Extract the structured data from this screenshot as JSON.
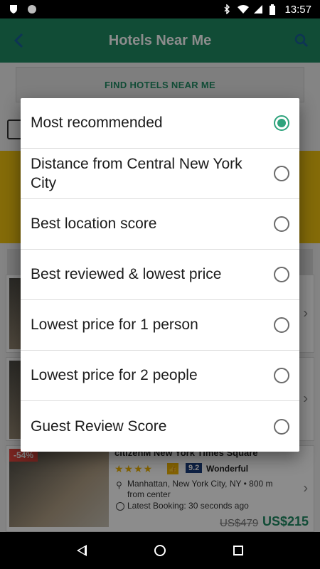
{
  "status_bar": {
    "time": "13:57"
  },
  "app": {
    "title": "Hotels Near Me",
    "find_button_label": "FIND HOTELS NEAR ME"
  },
  "hotel_card": {
    "discount": "-54%",
    "name": "citizenM New York Times Square",
    "stars": "★★★★",
    "score": "9.2",
    "score_label": "Wonderful",
    "location": "Manhattan, New York City, NY • 800 m from center",
    "latest_booking": "Latest Booking: 30 seconds ago",
    "old_price": "US$479",
    "new_price": "US$215"
  },
  "dialog": {
    "options": [
      {
        "label": "Most recommended",
        "selected": true
      },
      {
        "label": "Distance from Central New York City",
        "selected": false
      },
      {
        "label": "Best location score",
        "selected": false
      },
      {
        "label": "Best reviewed & lowest price",
        "selected": false
      },
      {
        "label": "Lowest price for 1 person",
        "selected": false
      },
      {
        "label": "Lowest price for 2 people",
        "selected": false
      },
      {
        "label": "Guest Review Score",
        "selected": false
      }
    ]
  },
  "colors": {
    "accent": "#2ea37c",
    "app_bar": "#1f8a63"
  }
}
